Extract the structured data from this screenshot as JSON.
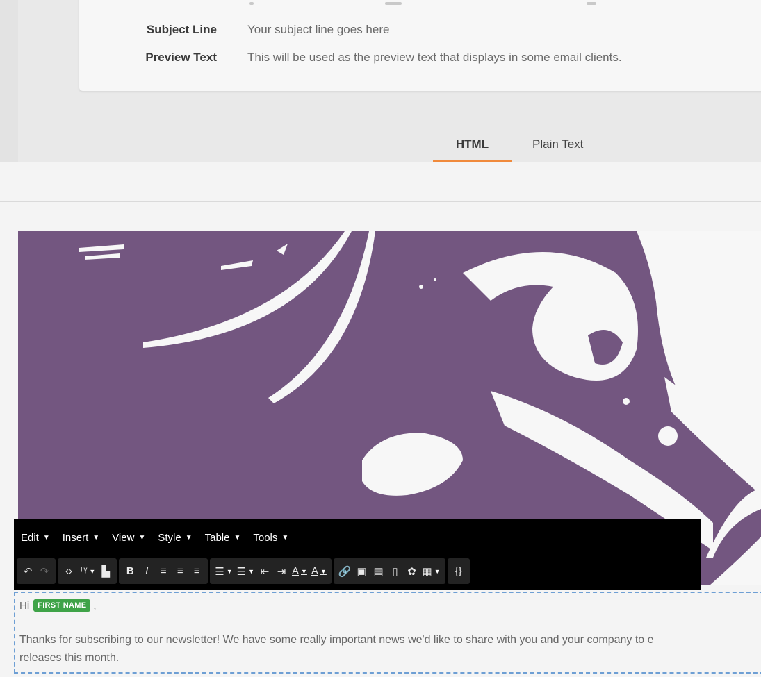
{
  "fields": {
    "subject_label": "Subject Line",
    "subject_value": "Your subject line goes here",
    "preview_label": "Preview Text",
    "preview_value": "This will be used as the preview text that displays in some email clients."
  },
  "tabs": {
    "html": "HTML",
    "plain": "Plain Text",
    "active": "HTML",
    "active_color": "#f08a3c"
  },
  "hero": {
    "background_color": "#735680",
    "foreground_color": "#f7f7f7"
  },
  "editor": {
    "menu": [
      "Edit",
      "Insert",
      "View",
      "Style",
      "Table",
      "Tools"
    ],
    "toolbar_icons": {
      "undo": "↶",
      "redo": "↷",
      "source": "‹›",
      "spellcheck": "ᵀᵞ",
      "find": "▙",
      "bold": "B",
      "italic": "I",
      "align_left": "≡",
      "align_center": "≡",
      "align_right": "≡",
      "bullet_list": "☰",
      "numbered_list": "☰",
      "outdent": "⇤",
      "indent": "⇥",
      "text_color": "A",
      "background_color": "A",
      "link": "🔗",
      "image": "▣",
      "media": "▤",
      "page": "▯",
      "emoticon": "✿",
      "table": "▦",
      "code": "{}"
    }
  },
  "content": {
    "greeting_prefix": "Hi",
    "merge_tag": "FIRST NAME",
    "greeting_suffix": ",",
    "body_line1": "Thanks for subscribing to our newsletter! We have some really important news we'd like to share with you and your company to e",
    "body_line2": "releases this month.",
    "merge_tag_color": "#3fa348",
    "border_color": "#6e9fd4"
  }
}
